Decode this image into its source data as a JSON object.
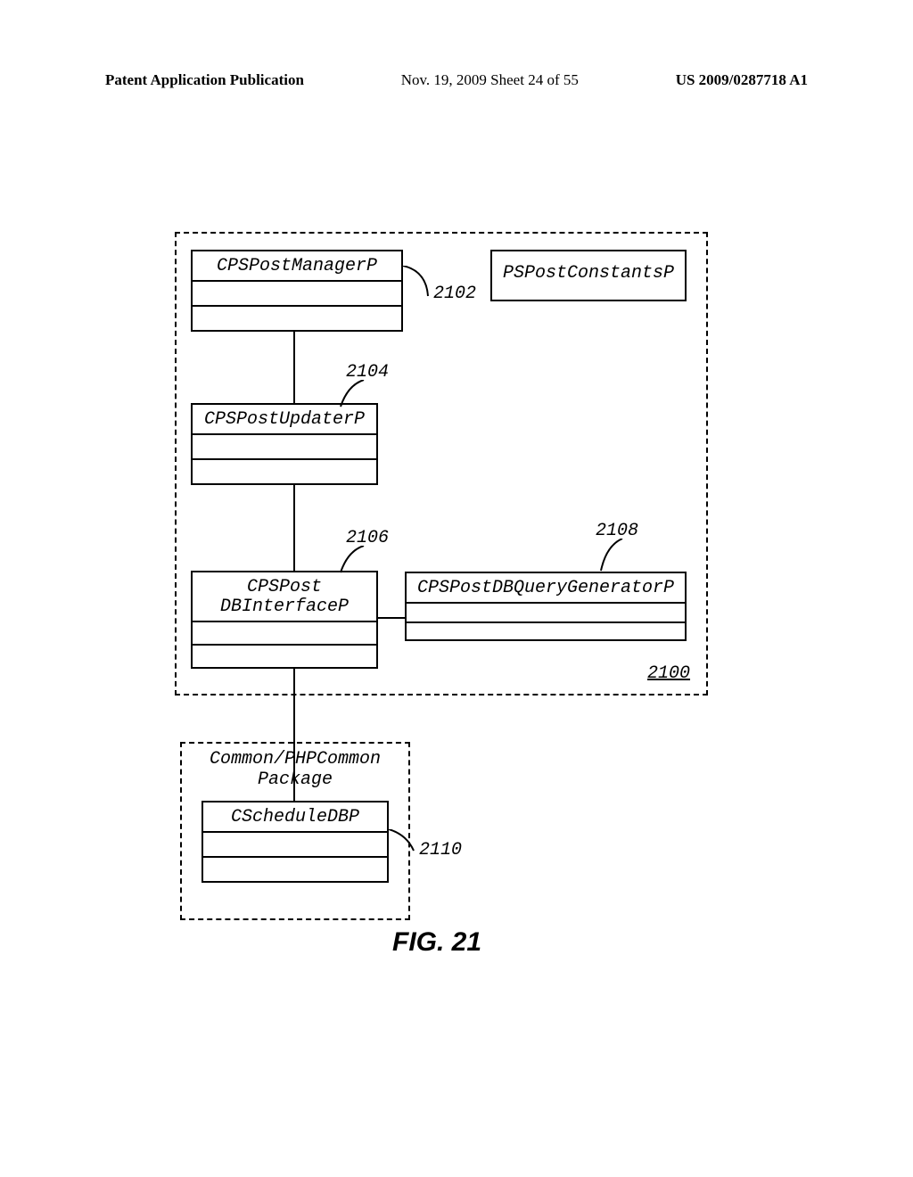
{
  "header": {
    "left": "Patent Application Publication",
    "mid": "Nov. 19, 2009  Sheet 24 of 55",
    "right": "US 2009/0287718 A1"
  },
  "boxes": {
    "post_manager": "CPSPostManagerP",
    "post_constants": "PSPostConstantsP",
    "post_updater": "CPSPostUpdaterP",
    "post_dbinterface": "CPSPost\nDBInterfaceP",
    "post_querygen": "CPSPostDBQueryGeneratorP",
    "package_label": "Common/PHPCommon\nPackage",
    "schedule_dbp": "CScheduleDBP"
  },
  "labels": {
    "n2102": "2102",
    "n2104": "2104",
    "n2106": "2106",
    "n2108": "2108",
    "n2100": "2100",
    "n2110": "2110"
  },
  "caption": "FIG. 21"
}
